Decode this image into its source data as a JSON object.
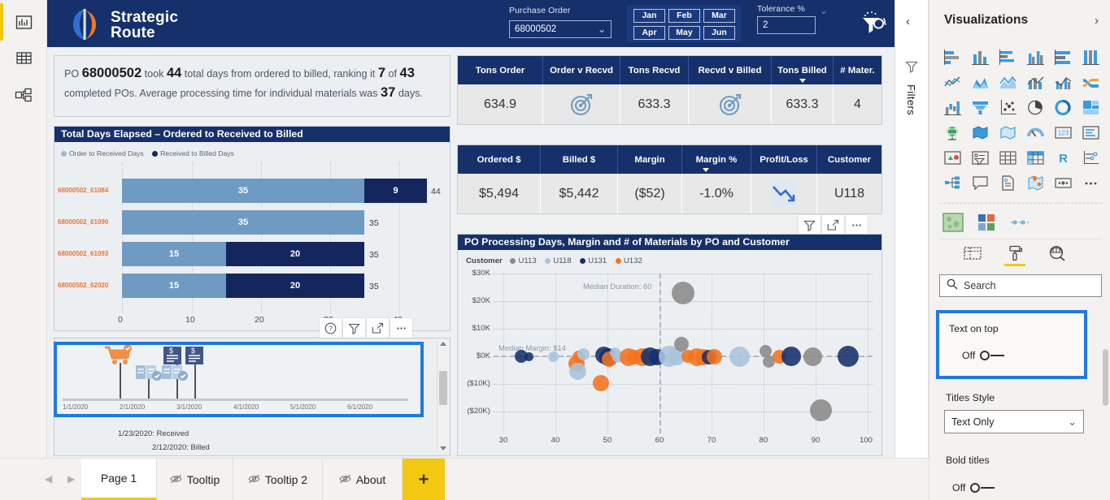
{
  "app": {
    "left_rail": [
      {
        "name": "report-view",
        "icon": "bar-chart-icon"
      },
      {
        "name": "data-view",
        "icon": "table-icon"
      },
      {
        "name": "model-view",
        "icon": "model-icon"
      }
    ]
  },
  "report": {
    "brand": {
      "line1": "Strategic",
      "line2": "Route"
    },
    "purchase_order": {
      "label": "Purchase Order",
      "value": "68000502",
      "chevron": "chevron-down-icon"
    },
    "months": [
      "Jan",
      "Feb",
      "Mar",
      "Apr",
      "May",
      "Jun"
    ],
    "tolerance": {
      "label": "Tolerance %",
      "value": "2"
    },
    "header_icons": [
      "clear-filters-icon",
      "info-icon"
    ],
    "summary": {
      "t1": "PO ",
      "po": "68000502",
      "t2": " took ",
      "days": "44",
      "t3": " total days from ordered to billed, ranking it ",
      "rank": "7",
      "t4": " of ",
      "total": "43",
      "t5": " completed POs. Average processing time for individual materials was ",
      "avg": "37",
      "t6": " days."
    },
    "bar_card": {
      "title": "Total Days Elapsed – Ordered to Received to Billed",
      "legend": [
        {
          "label": "Order to Received Days",
          "color": "#6f9bc3"
        },
        {
          "label": "Received to Billed Days",
          "color": "#13265e"
        }
      ],
      "footer_icons": [
        "help-icon",
        "filter-icon",
        "focus-mode-icon",
        "more-options-icon"
      ]
    },
    "gantt_card": {
      "ticks": [
        "1/1/2020",
        "2/1/2020",
        "3/1/2020",
        "4/1/2020",
        "5/1/2020",
        "6/1/2020"
      ],
      "notes": [
        "1/23/2020: Received",
        "2/12/2020: Billed"
      ],
      "markers": [
        {
          "icon": "cart-ordered-icon",
          "color": "#ef7622",
          "x": 28,
          "stem": 44
        },
        {
          "icon": "receipt-received-icon",
          "color": "#7ba3cc",
          "x": 60,
          "stem": 26
        },
        {
          "icon": "invoice-billed-icon",
          "color": "#15316f",
          "x": 96,
          "stem": 44
        },
        {
          "icon": "receipt-received-icon",
          "color": "#7ba3cc",
          "x": 108,
          "stem": 26
        },
        {
          "icon": "invoice-billed-icon",
          "color": "#15316f",
          "x": 118,
          "stem": 44
        }
      ]
    },
    "kpi_tons": {
      "columns": [
        "Tons Order",
        "Order v Recvd",
        "Tons Recvd",
        "Recvd v Billed",
        "Tons Billed",
        "# Mater."
      ],
      "sorted_column": "Tons Billed",
      "values": [
        "634.9",
        "target-icon",
        "633.3",
        "target-icon",
        "633.3",
        "4"
      ]
    },
    "kpi_money": {
      "columns": [
        "Ordered $",
        "Billed $",
        "Margin",
        "Margin %",
        "Profit/Loss",
        "Customer"
      ],
      "sorted_column": "Margin %",
      "values": [
        "$5,494",
        "$5,442",
        "($52)",
        "-1.0%",
        "trend-down-icon",
        "U118"
      ],
      "footer_icons": [
        "filter-icon",
        "focus-mode-icon",
        "more-options-icon"
      ]
    },
    "scatter_card": {
      "title": "PO Processing Days, Margin and # of Materials by PO and Customer",
      "legend_title": "Customer"
    }
  },
  "chart_data": [
    {
      "type": "bar",
      "title": "Total Days Elapsed – Ordered to Received to Billed",
      "orientation": "horizontal",
      "stacked": true,
      "categories": [
        "68000502_61084",
        "68000502_61090",
        "68000502_61093",
        "68000502_62020"
      ],
      "series": [
        {
          "name": "Order to Received Days",
          "color": "#6f9bc3",
          "values": [
            35,
            35,
            15,
            15
          ]
        },
        {
          "name": "Received to Billed Days",
          "color": "#13265e",
          "values": [
            9,
            0,
            20,
            20
          ]
        }
      ],
      "totals": [
        44,
        35,
        35,
        35
      ],
      "xlabel": "",
      "ylabel": "",
      "xticks": [
        0,
        10,
        20,
        30,
        40
      ],
      "xlim": [
        0,
        48
      ],
      "grid": true
    },
    {
      "type": "scatter",
      "title": "PO Processing Days, Margin and # of Materials by PO and Customer",
      "xlabel": "",
      "ylabel": "",
      "xticks": [
        30,
        40,
        50,
        60,
        70,
        80,
        90,
        100
      ],
      "yticks": [
        "$30K",
        "$20K",
        "$10K",
        "$0K",
        "($10K)",
        "($20K)"
      ],
      "ytick_values": [
        30000,
        20000,
        10000,
        0,
        -10000,
        -20000
      ],
      "xlim": [
        28,
        102
      ],
      "ylim": [
        -24000,
        32000
      ],
      "grid": true,
      "legend_position": "top",
      "legend": [
        {
          "name": "U113",
          "color": "#8a8a8a"
        },
        {
          "name": "U118",
          "color": "#a9c3dd"
        },
        {
          "name": "U131",
          "color": "#16306b"
        },
        {
          "name": "U132",
          "color": "#f4731f"
        }
      ],
      "reference_lines": [
        {
          "label": "Median Duration: 60",
          "axis": "x",
          "value": 60
        },
        {
          "label": "Median Margin: $14",
          "axis": "y",
          "value": 14
        }
      ],
      "points": [
        {
          "x": 33,
          "y": 0,
          "size": 16,
          "customer": "U131"
        },
        {
          "x": 34.5,
          "y": 0,
          "size": 11,
          "customer": "U131"
        },
        {
          "x": 38.5,
          "y": 0,
          "size": 13,
          "customer": "U118"
        },
        {
          "x": 42.5,
          "y": -2200,
          "size": 20,
          "customer": "U132"
        },
        {
          "x": 42.8,
          "y": -3600,
          "size": 21,
          "customer": "U118"
        },
        {
          "x": 43.2,
          "y": 0,
          "size": 15,
          "customer": "U132"
        },
        {
          "x": 44.2,
          "y": 600,
          "size": 15,
          "customer": "U118"
        },
        {
          "x": 47.3,
          "y": -9500,
          "size": 20,
          "customer": "U132"
        },
        {
          "x": 47.8,
          "y": 900,
          "size": 21,
          "customer": "U131"
        },
        {
          "x": 48.6,
          "y": 300,
          "size": 22,
          "customer": "U131"
        },
        {
          "x": 48.8,
          "y": -1200,
          "size": 19,
          "customer": "U132"
        },
        {
          "x": 50.3,
          "y": 900,
          "size": 13,
          "customer": "U118"
        },
        {
          "x": 50.6,
          "y": -300,
          "size": 15,
          "customer": "U118"
        },
        {
          "x": 52.3,
          "y": 0,
          "size": 22,
          "customer": "U132"
        },
        {
          "x": 53.6,
          "y": 0,
          "size": 18,
          "customer": "U132"
        },
        {
          "x": 54.8,
          "y": 0,
          "size": 22,
          "customer": "U132"
        },
        {
          "x": 56.3,
          "y": 0,
          "size": 23,
          "customer": "U131"
        },
        {
          "x": 57.6,
          "y": 0,
          "size": 20,
          "customer": "U131"
        },
        {
          "x": 59.8,
          "y": 300,
          "size": 26,
          "customer": "U118"
        },
        {
          "x": 61.2,
          "y": 0,
          "size": 21,
          "customer": "U118"
        },
        {
          "x": 63.2,
          "y": 3200,
          "size": 18,
          "customer": "U113"
        },
        {
          "x": 63.6,
          "y": 0,
          "size": 16,
          "customer": "U132"
        },
        {
          "x": 65.4,
          "y": 0,
          "size": 22,
          "customer": "U132"
        },
        {
          "x": 66.6,
          "y": 0,
          "size": 20,
          "customer": "U132"
        },
        {
          "x": 67.4,
          "y": 0,
          "size": 18,
          "customer": "U131"
        },
        {
          "x": 68.2,
          "y": 0,
          "size": 19,
          "customer": "U132"
        },
        {
          "x": 63.5,
          "y": 25000,
          "size": 28,
          "customer": "U113"
        },
        {
          "x": 72.6,
          "y": 0,
          "size": 25,
          "customer": "U118"
        },
        {
          "x": 78.2,
          "y": 2200,
          "size": 15,
          "customer": "U113"
        },
        {
          "x": 78.6,
          "y": -1800,
          "size": 15,
          "customer": "U113"
        },
        {
          "x": 80.8,
          "y": 0,
          "size": 17,
          "customer": "U132"
        },
        {
          "x": 82.8,
          "y": 0,
          "size": 24,
          "customer": "U131"
        },
        {
          "x": 86.8,
          "y": 0,
          "size": 23,
          "customer": "U113"
        },
        {
          "x": 88.4,
          "y": -19500,
          "size": 27,
          "customer": "U113"
        },
        {
          "x": 93.8,
          "y": 0,
          "size": 26,
          "customer": "U131"
        }
      ]
    }
  ],
  "filters_pane": {
    "label": "Filters",
    "collapse_icon": "chevron-left-icon",
    "funnel_icon": "filter-icon"
  },
  "viz_pane": {
    "title": "Visualizations",
    "expand_icon": "chevron-right-icon",
    "gallery": [
      "stacked-bar-chart-icon",
      "stacked-column-chart-icon",
      "clustered-bar-chart-icon",
      "clustered-column-chart-icon",
      "100-stacked-bar-chart-icon",
      "100-stacked-column-chart-icon",
      "line-chart-icon",
      "area-chart-icon",
      "stacked-area-chart-icon",
      "line-stacked-column-chart-icon",
      "line-clustered-column-chart-icon",
      "ribbon-chart-icon",
      "waterfall-chart-icon",
      "funnel-chart-icon",
      "scatter-chart-icon",
      "pie-chart-icon",
      "donut-chart-icon",
      "treemap-icon",
      "map-icon",
      "filled-map-icon",
      "shape-map-icon",
      "gauge-icon",
      "card-icon",
      "multi-row-card-icon",
      "kpi-icon",
      "slicer-icon",
      "table-icon",
      "matrix-icon",
      "r-script-visual-icon",
      "key-influencers-icon",
      "decomposition-tree-icon",
      "q-and-a-icon",
      "paginated-report-icon",
      "arcgis-map-icon",
      "power-apps-icon",
      "more-visuals-icon"
    ],
    "gallery2": [
      "custom-visual-green-icon",
      "custom-visual-squares-icon",
      "custom-visual-dots-icon"
    ],
    "tabs": [
      "fields-tab-icon",
      "format-tab-icon",
      "analytics-tab-icon"
    ],
    "active_tab": "format-tab-icon",
    "search": {
      "placeholder": "Search",
      "icon": "search-icon"
    },
    "format": {
      "text_on_top": {
        "label": "Text on top",
        "state": "Off"
      },
      "titles_style": {
        "label": "Titles Style",
        "value": "Text Only",
        "chevron": "chevron-down-icon"
      },
      "bold_titles": {
        "label": "Bold titles",
        "state": "Off"
      }
    }
  },
  "tabbar": {
    "prev_icon": "chevron-left-icon",
    "next_icon": "chevron-right-icon",
    "tabs": [
      {
        "label": "Page 1",
        "hidden": false,
        "active": true
      },
      {
        "label": "Tooltip",
        "hidden": true,
        "active": false
      },
      {
        "label": "Tooltip 2",
        "hidden": true,
        "active": false
      },
      {
        "label": "About",
        "hidden": true,
        "active": false
      }
    ],
    "add_label": "+"
  },
  "colors": {
    "brand_navy": "#16306b",
    "brand_orange": "#ef7622",
    "accent_yellow": "#f2c811",
    "highlight_blue": "#1f7ae0"
  }
}
